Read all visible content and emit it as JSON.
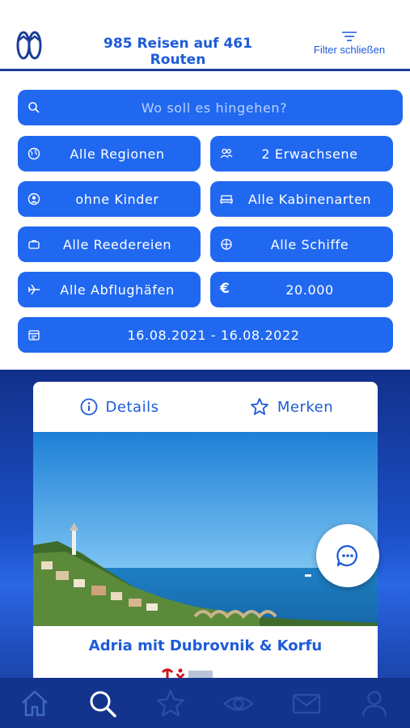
{
  "header": {
    "title": "985 Reisen auf 461 Routen",
    "filter_label": "Filter schließen"
  },
  "filters": {
    "search_placeholder": "Wo soll es hingehen?",
    "region": "Alle Regionen",
    "adults": "2 Erwachsene",
    "children": "ohne Kinder",
    "cabin": "Alle Kabinenarten",
    "shipping_company": "Alle Reedereien",
    "ship": "Alle Schiffe",
    "airport": "Alle Abflughäfen",
    "currency_symbol": "€",
    "price": "20.000",
    "date_range": "16.08.2021 -  16.08.2022"
  },
  "card": {
    "tab_details": "Details",
    "tab_save": "Merken",
    "title": "Adria mit Dubrovnik & Korfu"
  },
  "tabbar": {
    "items": [
      "home-icon",
      "search-icon",
      "star-icon",
      "eye-icon",
      "mail-icon",
      "user-icon"
    ],
    "active": "search-icon"
  },
  "colors": {
    "primary": "#2168f0",
    "text_blue": "#1d5bd8",
    "navy": "#14338c"
  }
}
